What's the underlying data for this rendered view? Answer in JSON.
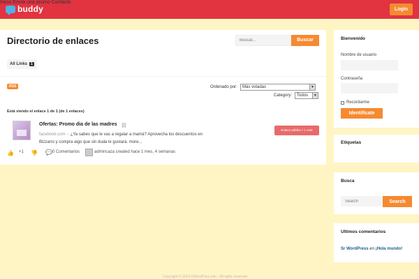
{
  "header": {
    "brand": "buddy",
    "nav": [
      "Inicio",
      "Envía una promo",
      "Contacto"
    ],
    "login": "Login"
  },
  "main": {
    "title": "Directorio de enlaces",
    "search_placeholder": "Buscar...",
    "search_button": "Buscar",
    "tab_all": "All Links",
    "tab_count": "1",
    "rss": "RSS",
    "order_label": "Ordenado por:",
    "order_value": "Más votadas",
    "category_label": "Category:",
    "category_value": "Todos",
    "viewing": "Está viendo el enlace 1 de 1 (de 1 enlaces)",
    "link": {
      "title": "Ofertas: Promo dia de las madres",
      "domain": "facebook.com",
      "sep": " -- ",
      "description": "¿Ya sabes que le vas a regalar a mamá? Aprovecha los descuentos en Bizzarro y compra algo que sin duda le gustará.",
      "more": "more...",
      "badge": "Enlace público / 1 vote",
      "votes": "+1",
      "comments": "0 Comentarios",
      "meta": "admincaza created hace 1 mes, 4 semanas"
    },
    "footer": "Copyright © 2014 GWordPool.com - All rights reserved"
  },
  "sidebar": {
    "welcome": {
      "title": "Bienvenido",
      "user_label": "Nombre de usuario",
      "pass_label": "Contraseña",
      "remember": "Recordarme",
      "submit": "Identifícate"
    },
    "tags": {
      "title": "Etiquetas"
    },
    "search": {
      "title": "Busca",
      "placeholder": "Search",
      "button": "Search"
    },
    "comments": {
      "title": "Ultimos comentarios",
      "author": "Sr WordPress",
      "connector": " en ",
      "post": "¡Hola mundo!"
    }
  },
  "colors": {
    "topbar": "#e13340",
    "accent": "#f58a31",
    "background": "#fff5c4",
    "badge": "#e86a6a"
  }
}
